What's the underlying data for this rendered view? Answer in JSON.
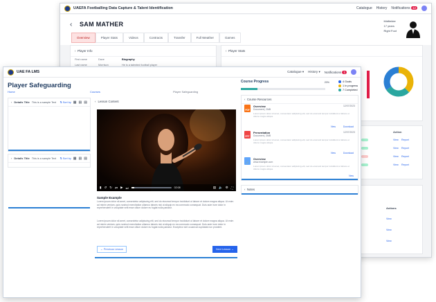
{
  "back_app": {
    "title": "UAEFA Footballing Data Capture & Talent Identification",
    "nav": {
      "catalogue": "Catalogue",
      "history": "History",
      "notifications": "Notifications",
      "notif_count": "12"
    },
    "player_name": "SAM MATHER",
    "tabs": [
      "Overview",
      "Player Stats",
      "Videos",
      "Contracts",
      "Transfer",
      "Full Weather",
      "Games"
    ],
    "meta": [
      "Midfielder",
      "17 years",
      "Right Foot"
    ],
    "player_info": {
      "heading": "Player Info",
      "rows": [
        {
          "label": "First name",
          "value": "Dave",
          "label2": "Biography"
        },
        {
          "label": "Last name",
          "value": "Morrison",
          "label2": "He is a talented football player"
        }
      ]
    },
    "player_stats_heading": "Player Stats",
    "table": {
      "action_col": "Action",
      "actions_col": "Actions",
      "view": "View",
      "report": "Report"
    }
  },
  "front_app": {
    "title": "UAE FA LMS",
    "nav": {
      "catalogue": "Catalogue",
      "history": "History",
      "notifications": "Notifications",
      "notif_count": "1"
    },
    "page_title": "Player Safeguarding",
    "breadcrumbs": {
      "home": "Home",
      "courses": "Courses",
      "current": "Player Safeguarding"
    },
    "side_cards": [
      {
        "title": "Details Title",
        "input_text": "This is a sample Text",
        "sort": "Sort by"
      },
      {
        "title": "Details Title",
        "input_text": "This is a sample Text",
        "sort": "Sort by"
      }
    ],
    "lesson": {
      "heading": "Lesson Content",
      "video": {
        "time": "02:08",
        "progress": 0.08
      },
      "sample_title": "Sample Example",
      "paragraph1": "Lorem ipsum dolor sit amet, consectetur adipiscing elit, sed do eiusmod tempor incididunt ut labore et dolore magna aliqua. Ut enim ad minim veniam, quis nostrud exercitation ullamco laboris nisi ut aliquip ex ea commodo consequat. Duis aute irure dolor in reprehenderit in voluptate velit esse cillum dolore eu fugiat nulla pariatur.",
      "paragraph2": "Lorem ipsum dolor sit amet, consectetur adipiscing elit, sed do eiusmod tempor incididunt ut labore et dolore magna aliqua. Ut enim ad minim veniam, quis nostrud exercitation ullamco laboris nisi ut aliquip ex ea commodo consequat. Duis aute irure dolor in reprehenderit in voluptate velit esse cillum dolore eu fugiat nulla pariatur. Excepteur sint occaecat cupidatat non proident.",
      "prev": "Previous Lesson",
      "next": "Next Lesson"
    },
    "progress": {
      "title": "Course Progress",
      "percent": "20%",
      "value": 0.2,
      "legend": [
        {
          "label": "4 Goals",
          "color": "#2563eb"
        },
        {
          "label": "1 In progress",
          "color": "#eab308"
        },
        {
          "label": "7 Completed",
          "color": "#2aa7a0"
        }
      ]
    },
    "resources": {
      "heading": "Course Resources",
      "items": [
        {
          "name": "Overview",
          "file": "Document | 2MB",
          "date": "12/07/2023",
          "desc": "Lorem ipsum dolor sit amet, consectetur adipiscing elit, sed do eiusmod tempor incididunt ut labore et dolore magna aliqua.",
          "view": "View",
          "download": "Download",
          "type": "PDF",
          "color": "#f97316"
        },
        {
          "name": "Presentation",
          "file": "Document | 3MB",
          "date": "12/07/2023",
          "desc": "Lorem ipsum dolor sit amet, consectetur adipiscing elit, sed do eiusmod tempor incididunt ut labore et dolore magna aliqua.",
          "view": "View",
          "download": "Download",
          "type": "PPT",
          "color": "#ef4444"
        },
        {
          "name": "Overview",
          "file": "www.example.com",
          "date": "12/07/2023",
          "desc": "Lorem ipsum dolor sit amet, consectetur adipiscing elit, sed do eiusmod tempor incididunt ut labore et dolore magna aliqua.",
          "view": "View",
          "download": "",
          "type": "",
          "color": "#60a5fa"
        }
      ]
    },
    "notes_heading": "Notes"
  }
}
